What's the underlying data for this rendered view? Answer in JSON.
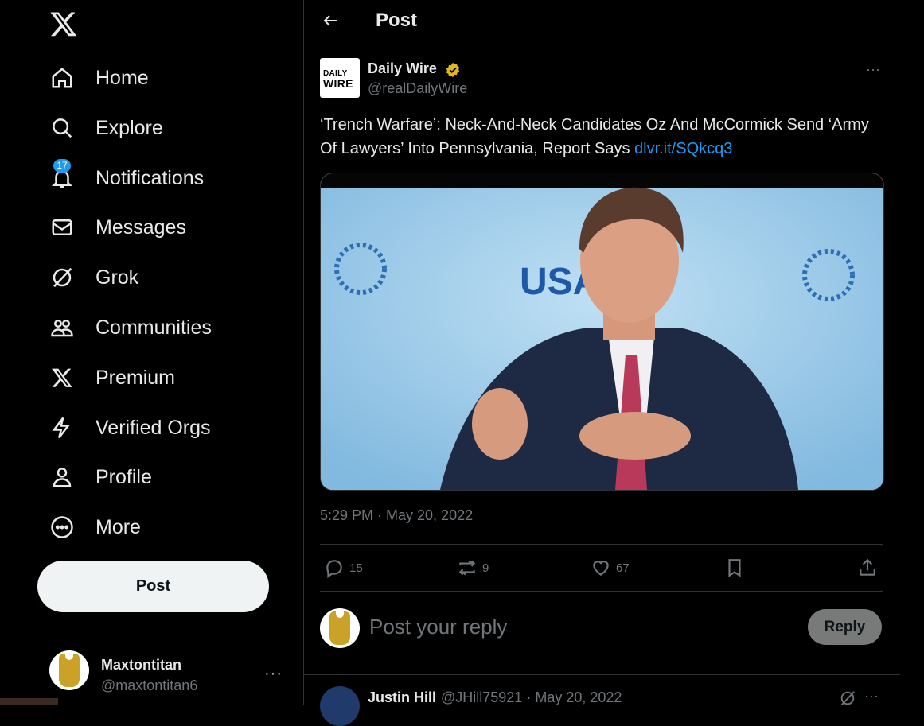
{
  "sidebar": {
    "logo": "x-logo-icon",
    "items": [
      {
        "label": "Home",
        "icon": "home-icon"
      },
      {
        "label": "Explore",
        "icon": "search-icon"
      },
      {
        "label": "Notifications",
        "icon": "bell-icon",
        "badge": "17"
      },
      {
        "label": "Messages",
        "icon": "envelope-icon"
      },
      {
        "label": "Grok",
        "icon": "grok-icon"
      },
      {
        "label": "Communities",
        "icon": "people-icon"
      },
      {
        "label": "Premium",
        "icon": "x-logo-icon"
      },
      {
        "label": "Verified Orgs",
        "icon": "lightning-icon"
      },
      {
        "label": "Profile",
        "icon": "person-icon"
      },
      {
        "label": "More",
        "icon": "more-circle-icon"
      }
    ],
    "post_button": "Post",
    "account": {
      "name": "Maxtontitan",
      "handle": "@maxtontitan6",
      "more": "···"
    }
  },
  "header": {
    "title": "Post"
  },
  "post": {
    "author": {
      "name": "Daily Wire",
      "handle": "@realDailyWire",
      "logo_line1": "DAILY",
      "logo_line2": "WIRE"
    },
    "more": "···",
    "text": "‘Trench Warfare’: Neck-And-Neck Candidates Oz And McCormick Send ‘Army Of Lawyers’ Into Pennsylvania, Report Says ",
    "link": "dlvr.it/SQkcq3",
    "timestamp": "5:29 PM · May 20, 2022",
    "media_backdrop_text": "USA",
    "actions": {
      "replies": "15",
      "reposts": "9",
      "likes": "67"
    }
  },
  "reply_box": {
    "placeholder": "Post your reply",
    "button": "Reply"
  },
  "next_reply": {
    "name": "Justin Hill",
    "meta": "@JHill75921 · May 20, 2022",
    "more": "···"
  },
  "colors": {
    "background": "#000000",
    "text": "#e7e9ea",
    "muted": "#71767b",
    "accent": "#1d9bf0",
    "border": "#2f3336",
    "verified_gold": "#e2b719"
  }
}
